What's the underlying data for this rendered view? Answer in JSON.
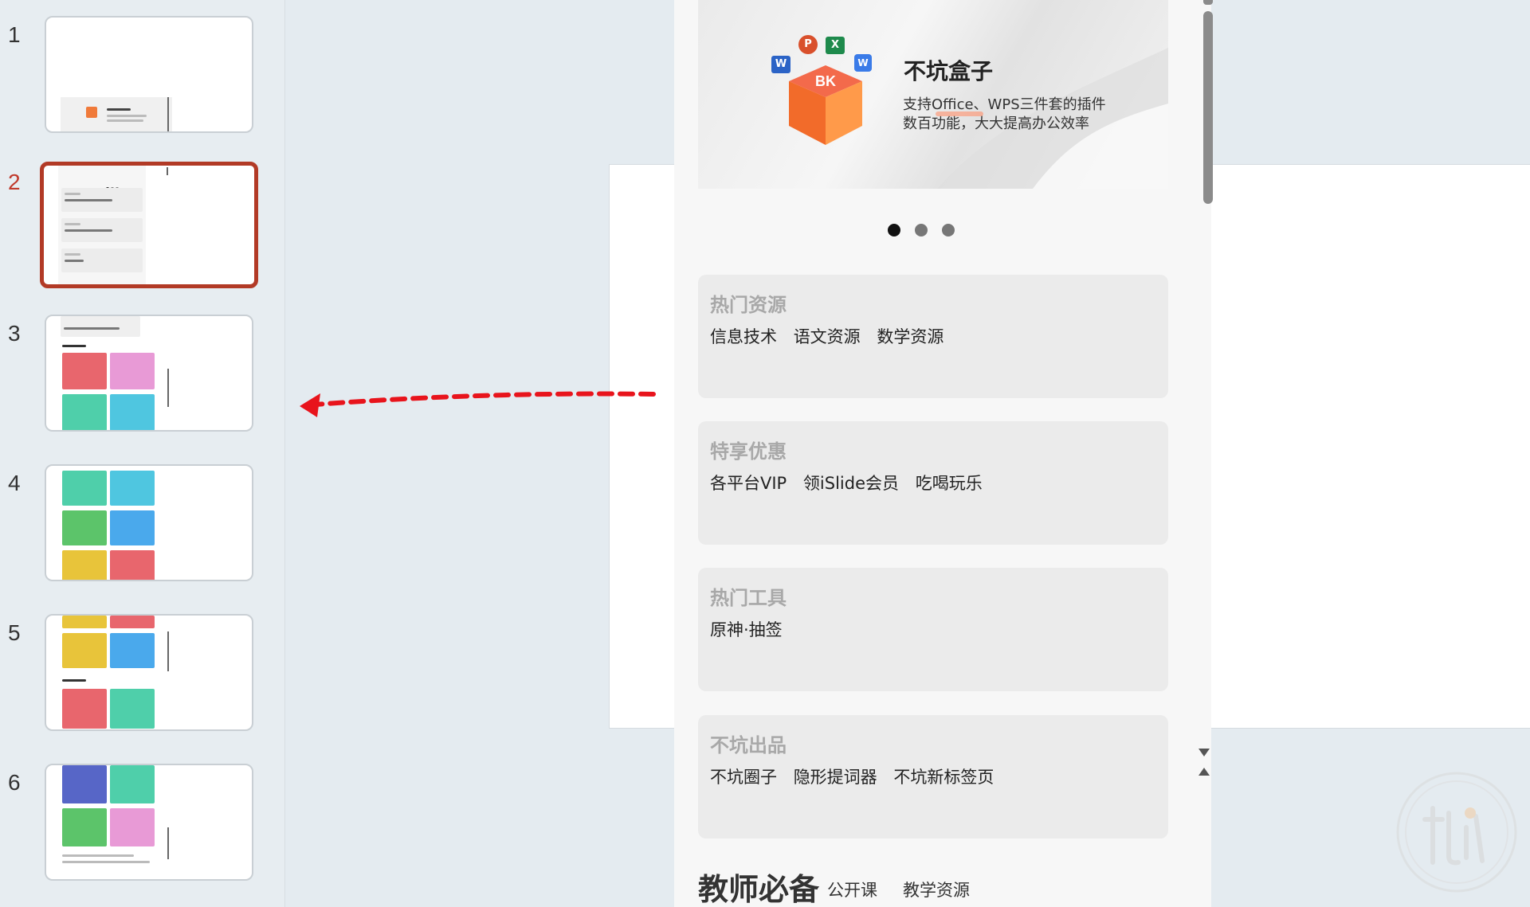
{
  "thumbnails": [
    {
      "number": "1"
    },
    {
      "number": "2"
    },
    {
      "number": "3"
    },
    {
      "number": "4"
    },
    {
      "number": "5"
    },
    {
      "number": "6"
    }
  ],
  "active_slide": "2",
  "banner": {
    "title": "不坑盒子",
    "subtitle_line1": "支持Office、WPS三件套的插件",
    "subtitle_line2": "数百功能，大大提高办公效率",
    "logo_text": "BK"
  },
  "carousel": {
    "count": 3,
    "active_index": 0
  },
  "sections": [
    {
      "title": "热门资源",
      "items": [
        "信息技术",
        "语文资源",
        "数学资源"
      ]
    },
    {
      "title": "特享优惠",
      "items": [
        "各平台VIP",
        "领iSlide会员",
        "吃喝玩乐"
      ]
    },
    {
      "title": "热门工具",
      "items": [
        "原神·抽签"
      ]
    },
    {
      "title": "不坑出品",
      "items": [
        "不坑圈子",
        "隐形提词器",
        "不坑新标签页"
      ]
    }
  ],
  "teacher": {
    "title": "教师必备",
    "tabs": [
      "公开课",
      "教学资源"
    ]
  },
  "colors": {
    "active_border": "#b23a26",
    "arrow": "#e8141c",
    "card_bg": "#ebebeb"
  }
}
